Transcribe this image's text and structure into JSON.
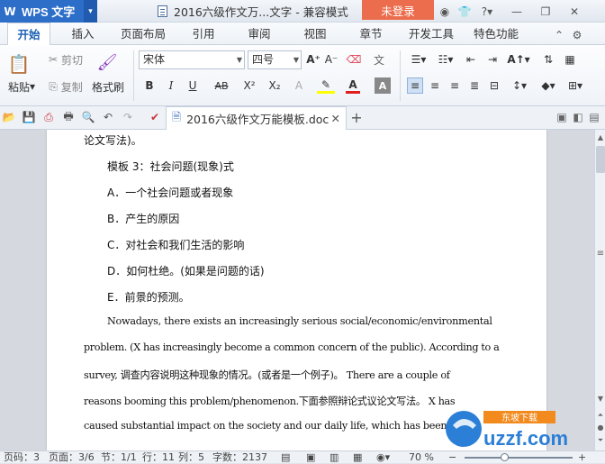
{
  "app": {
    "name": "WPS 文字",
    "logo": "W"
  },
  "title": {
    "text": "2016六级作文万...文字 - 兼容模式",
    "login": "未登录"
  },
  "tabs": [
    "开始",
    "插入",
    "页面布局",
    "引用",
    "审阅",
    "视图",
    "章节",
    "开发工具",
    "特色功能"
  ],
  "ribbon": {
    "paste": "粘贴",
    "cut": "剪切",
    "copy": "复制",
    "format_painter": "格式刷",
    "font_name": "宋体",
    "font_size": "四号",
    "bold": "B",
    "italic": "I",
    "underline": "U",
    "strike": "AB",
    "sup": "X²",
    "sub": "X₂"
  },
  "doc_tab": {
    "name": "2016六级作文万能模板.doc"
  },
  "document": {
    "lines": [
      "论文写法)。",
      "模板 3：社会问题(现象)式",
      "A．一个社会问题或者现象",
      "B．产生的原因",
      "C．对社会和我们生活的影响",
      "D．如何杜绝。(如果是问题的话)",
      "E．前景的预测。",
      "Nowadays, there exists an increasingly serious social/economic/environmental",
      "problem. (X has increasingly become a common concern of the public). According to a",
      "survey, 调查内容说明这种现象的情况。(或者是一个例子)。 There are a couple of",
      "reasons booming this problem/phenomenon.下面参照辩论式议论文写法。 X has",
      "caused substantial impact on the society and our daily life, which has been an"
    ]
  },
  "status": {
    "page_num": "页码：3",
    "page": "页面：3/6",
    "section": "节：1/1",
    "row": "行：11",
    "col": "列：5",
    "words": "字数：2137",
    "zoom": "70 %"
  },
  "watermark": {
    "text": "uzzf.com",
    "sub": "东坡下载"
  },
  "colors": {
    "accent": "#2d6ec9",
    "login": "#ec6d4d",
    "highlight": "#ffff00",
    "font_color": "#e02020"
  }
}
